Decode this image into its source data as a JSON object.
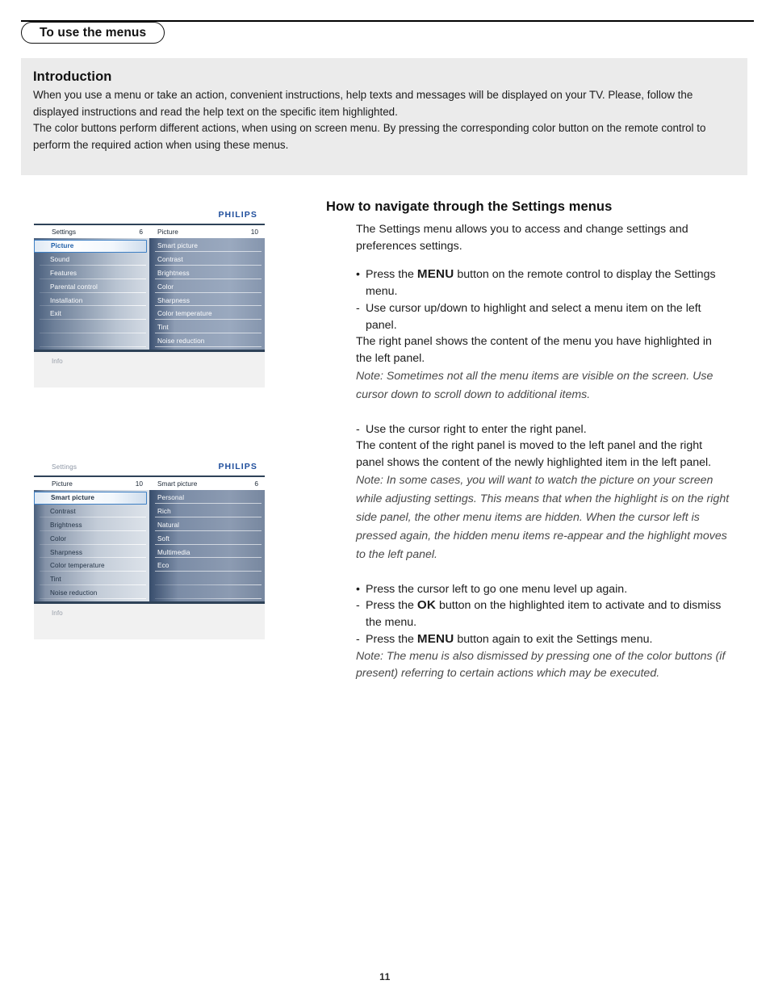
{
  "header": {
    "chapter_label": "To use the menus"
  },
  "intro": {
    "title": "Introduction",
    "paragraph1": "When you use a menu or take an action, convenient instructions, help texts and messages will be displayed on your TV. Please, follow the displayed instructions and read the help text on the specific item highlighted.",
    "paragraph2": "The color buttons perform different actions, when using on screen menu. By pressing the corresponding color button on the remote control to perform the required action when using these menus."
  },
  "tv_menu_1": {
    "brand": "PHILIPS",
    "left_header": {
      "title": "Settings",
      "count": "6"
    },
    "right_header": {
      "title": "Picture",
      "count": "10"
    },
    "left_items": [
      "Picture",
      "Sound",
      "Features",
      "Parental control",
      "Installation",
      "Exit",
      "",
      ""
    ],
    "left_selected_index": 0,
    "right_items": [
      "Smart picture",
      "Contrast",
      "Brightness",
      "Color",
      "Sharpness",
      "Color temperature",
      "Tint",
      "Noise reduction"
    ],
    "info_label": "Info"
  },
  "tv_menu_2": {
    "brand": "PHILIPS",
    "breadcrumb": "Settings",
    "left_header": {
      "title": "Picture",
      "count": "10"
    },
    "right_header": {
      "title": "Smart picture",
      "count": "6"
    },
    "left_items": [
      "Smart picture",
      "Contrast",
      "Brightness",
      "Color",
      "Sharpness",
      "Color temperature",
      "Tint",
      "Noise reduction"
    ],
    "left_selected_index": 0,
    "right_items": [
      "Personal",
      "Rich",
      "Natural",
      "Soft",
      "Multimedia",
      "Eco",
      "",
      ""
    ],
    "info_label": "Info"
  },
  "guide": {
    "heading": "How to navigate through the Settings menus",
    "intro_text": "The Settings menu allows you to access and change settings and preferences settings.",
    "b1_mark": "•",
    "b1_pre": "Press the ",
    "b1_key": "MENU",
    "b1_post": " button on the remote control to display the Settings menu.",
    "b2_mark": "-",
    "b2_text": "Use cursor up/down to highlight and select a menu item on the left panel.",
    "p_right_panel": "The right panel shows the content of the menu you have highlighted in the left panel.",
    "note1": "Note: Sometimes not all the menu items are visible on the screen. Use cursor down to scroll down to additional items.",
    "b3_mark": "-",
    "b3_text": "Use the cursor right to enter the right panel.",
    "p_moved": "The content of the right panel is moved to the left panel and the right panel shows the content of the newly highlighted item in the left panel.",
    "note2": "Note: In some cases, you will want to watch the picture on your screen while adjusting settings. This means that when the highlight is on the right side panel, the other menu items are hidden. When the cursor left is pressed again, the hidden menu items re-appear and the highlight moves to the left panel.",
    "b4_mark": "•",
    "b4_text": "Press the cursor left to go one menu level up again.",
    "b5_mark": "-",
    "b5_pre": "Press the ",
    "b5_key": "OK",
    "b5_post": " button on the highlighted item to activate and to dismiss the menu.",
    "b6_mark": "-",
    "b6_pre": "Press the ",
    "b6_key": "MENU",
    "b6_post": " button again to exit the Settings menu.",
    "note3": "Note: The menu is also dismissed by pressing one of the color buttons (if present) referring to certain actions which may be executed."
  },
  "footer": {
    "page_number": "11"
  },
  "colors": {
    "philips_blue": "#1f4e9c",
    "highlight_border": "#3d7fc4",
    "highlight_text": "#1f5fa8",
    "intro_background": "#ebebeb"
  }
}
